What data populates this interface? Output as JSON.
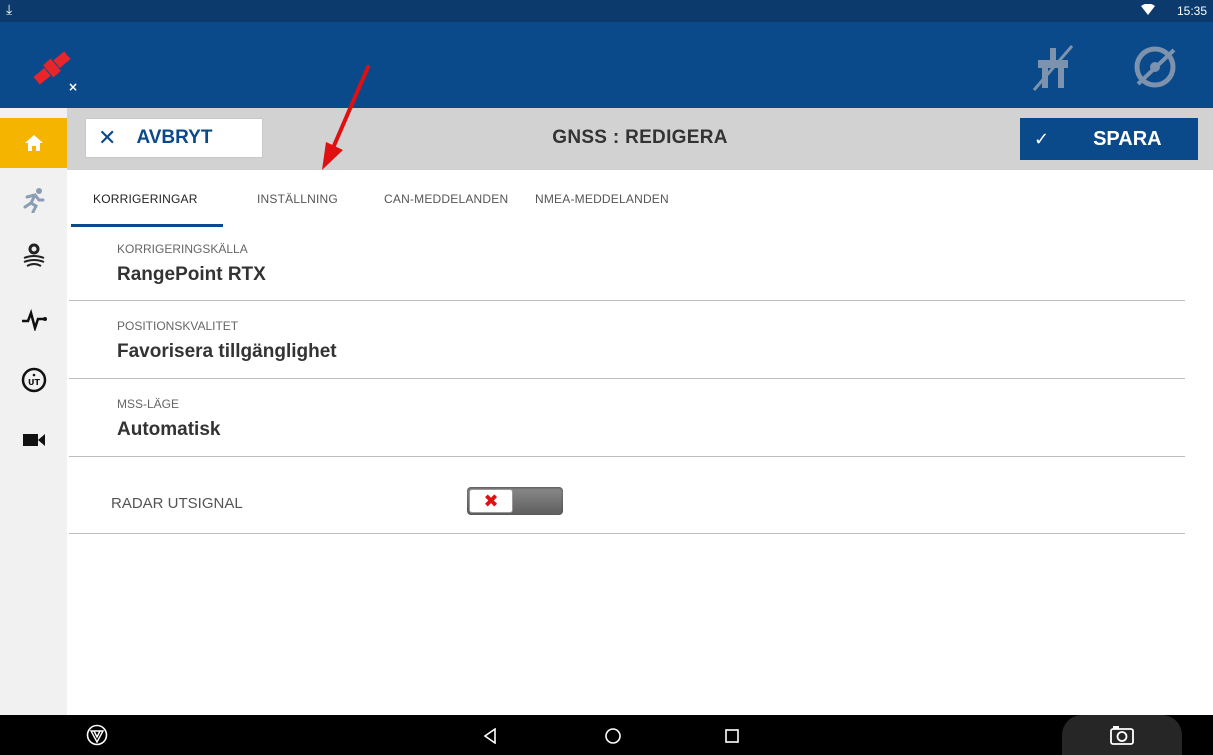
{
  "status_bar": {
    "download_icon": "download-icon",
    "wifi_icon": "wifi-icon",
    "time": "15:35"
  },
  "header": {
    "gnss_status_icon": "satellite-error-icon",
    "icons": [
      "implement-off-icon",
      "steering-disabled-icon"
    ]
  },
  "sidebar": {
    "items": [
      {
        "icon": "home-icon",
        "active": true
      },
      {
        "icon": "running-man-icon"
      },
      {
        "icon": "field-settings-icon"
      },
      {
        "icon": "pulse-icon"
      },
      {
        "icon": "ut-icon"
      },
      {
        "icon": "camera-icon"
      }
    ]
  },
  "toolbar": {
    "cancel_label": "AVBRYT",
    "title": "GNSS : REDIGERA",
    "save_label": "SPARA"
  },
  "tabs": [
    {
      "label": "KORRIGERINGAR",
      "active": true
    },
    {
      "label": "INSTÄLLNING"
    },
    {
      "label": "CAN-MEDDELANDEN"
    },
    {
      "label": "NMEA-MEDDELANDEN"
    }
  ],
  "settings": [
    {
      "caption": "KORRIGERINGSKÄLLA",
      "value": "RangePoint RTX"
    },
    {
      "caption": "POSITIONSKVALITET",
      "value": "Favorisera tillgänglighet"
    },
    {
      "caption": "MSS-LÄGE",
      "value": "Automatisk"
    }
  ],
  "radar": {
    "label": "RADAR UTSIGNAL",
    "enabled": false
  },
  "nav_bar": {
    "icons": [
      "trimble-icon",
      "back-icon",
      "home-circle-icon",
      "recents-icon",
      "screenshot-camera-icon"
    ]
  },
  "colors": {
    "header": "#0b4a8a",
    "status_bar": "#0c3a6c",
    "accent_home": "#f5b400",
    "arrow": "#e01010"
  }
}
